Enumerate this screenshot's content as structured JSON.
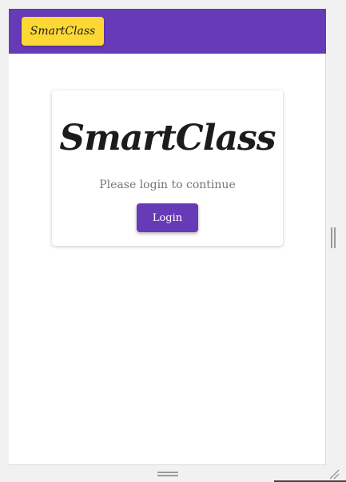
{
  "app": {
    "brand_label": "SmartClass"
  },
  "card": {
    "title": "SmartClass",
    "subtitle": "Please login to continue",
    "login_label": "Login"
  },
  "colors": {
    "appbar": "#673ab7",
    "brand_button": "#fdd835",
    "login_button": "#673ab7"
  },
  "icons": {
    "vertical_handle": "drag-handle-vertical-icon",
    "horizontal_handle": "drag-handle-horizontal-icon",
    "resize": "resize-grip-icon"
  }
}
